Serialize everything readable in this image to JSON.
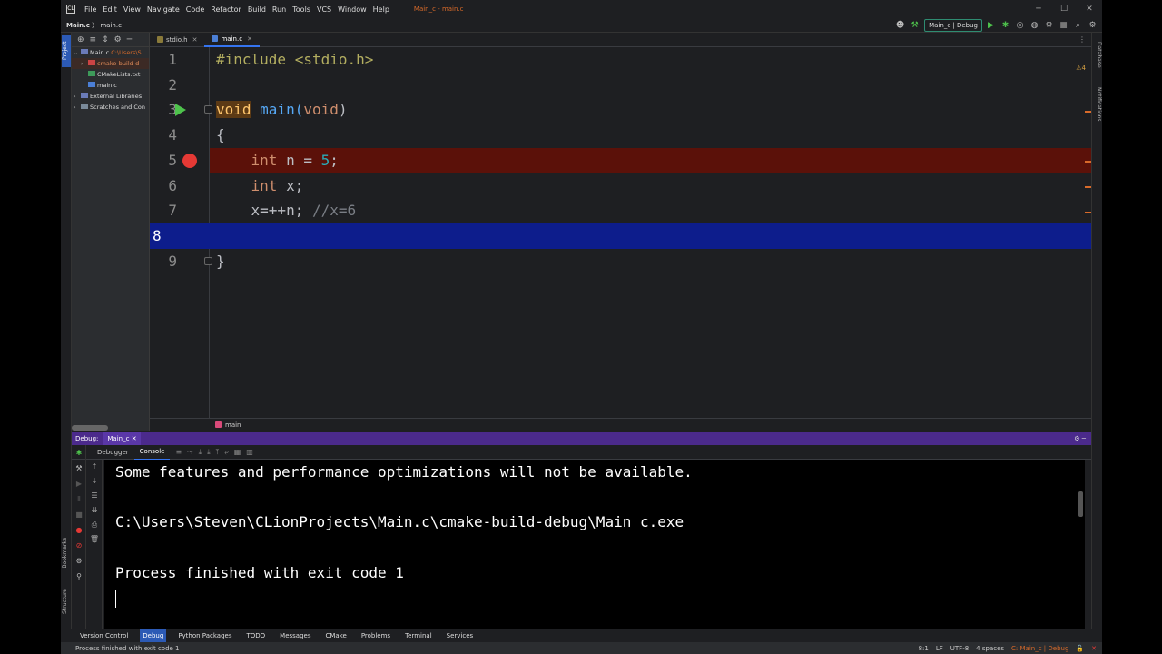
{
  "window": {
    "title": "Main_c - main.c",
    "app_icon": "CL",
    "controls": [
      "─",
      "☐",
      "✕"
    ]
  },
  "menu": [
    "File",
    "Edit",
    "View",
    "Navigate",
    "Code",
    "Refactor",
    "Build",
    "Run",
    "Tools",
    "VCS",
    "Window",
    "Help"
  ],
  "breadcrumb": {
    "project": "Main.c",
    "sep": "〉",
    "file": "main.c"
  },
  "toolbar": {
    "run_config": "Main_c | Debug",
    "icons": [
      "account-icon",
      "hammer-icon",
      "run-icon",
      "debug-icon",
      "profile-icon",
      "coverage-icon",
      "attach-icon",
      "stop-icon",
      "search-icon",
      "settings-icon"
    ]
  },
  "project_tree": [
    {
      "label": "Main.c",
      "extra": "C:\\Users\\S",
      "expanded": true,
      "folder": true
    },
    {
      "label": "cmake-build-d",
      "folder": true,
      "excluded": true
    },
    {
      "label": "CMakeLists.txt",
      "folder": false
    },
    {
      "label": "main.c",
      "folder": false
    },
    {
      "label": "External Libraries",
      "folder": false
    },
    {
      "label": "Scratches and Con",
      "folder": false
    }
  ],
  "left_strip": {
    "project": "Project",
    "bookmarks": "Bookmarks",
    "structure": "Structure"
  },
  "right_strip": {
    "database": "Database",
    "notifications": "Notifications"
  },
  "tabs": [
    {
      "label": "stdio.h",
      "active": false
    },
    {
      "label": "main.c",
      "active": true
    }
  ],
  "close_glyph": "✕",
  "editor": {
    "warnings": "⚠4",
    "lines": [
      "1",
      "2",
      "3",
      "4",
      "5",
      "6",
      "7",
      "8",
      "9"
    ],
    "code": {
      "l1": "#include <stdio.h>",
      "l3_kw": "void",
      "l3_fn": " main(",
      "l3_arg": "void",
      "l3_end": ")",
      "l4": "{",
      "l5_kw": "    int",
      "l5_mid": " n = ",
      "l5_num": "5",
      "l5_end": ";",
      "l6_kw": "    int",
      "l6_rest": " x;",
      "l7_code": "    x=++n; ",
      "l7_comment": "//x=6",
      "l9": "}"
    },
    "breadcrumb_fn": "main"
  },
  "debug": {
    "label": "Debug:",
    "session": "Main_c",
    "tabs": [
      "Debugger",
      "Console"
    ],
    "console": [
      "Some features and performance optimizations will not be available.",
      "",
      "C:\\Users\\Steven\\CLionProjects\\Main.c\\cmake-build-debug\\Main_c.exe",
      "",
      "Process finished with exit code 1"
    ]
  },
  "toolwindows": [
    "Version Control",
    "Debug",
    "Python Packages",
    "TODO",
    "Messages",
    "CMake",
    "Problems",
    "Terminal",
    "Services"
  ],
  "status": {
    "message": "Process finished with exit code 1",
    "position": "8:1",
    "line_sep": "LF",
    "encoding": "UTF-8",
    "indent": "4 spaces",
    "config": "C: Main_c | Debug"
  },
  "colors": {
    "accent": "#3574f0",
    "debug_header": "#4b2a8c",
    "breakpoint_line": "#5b1109",
    "exec_line": "#0d1d8c",
    "breakpoint": "#e53935"
  }
}
